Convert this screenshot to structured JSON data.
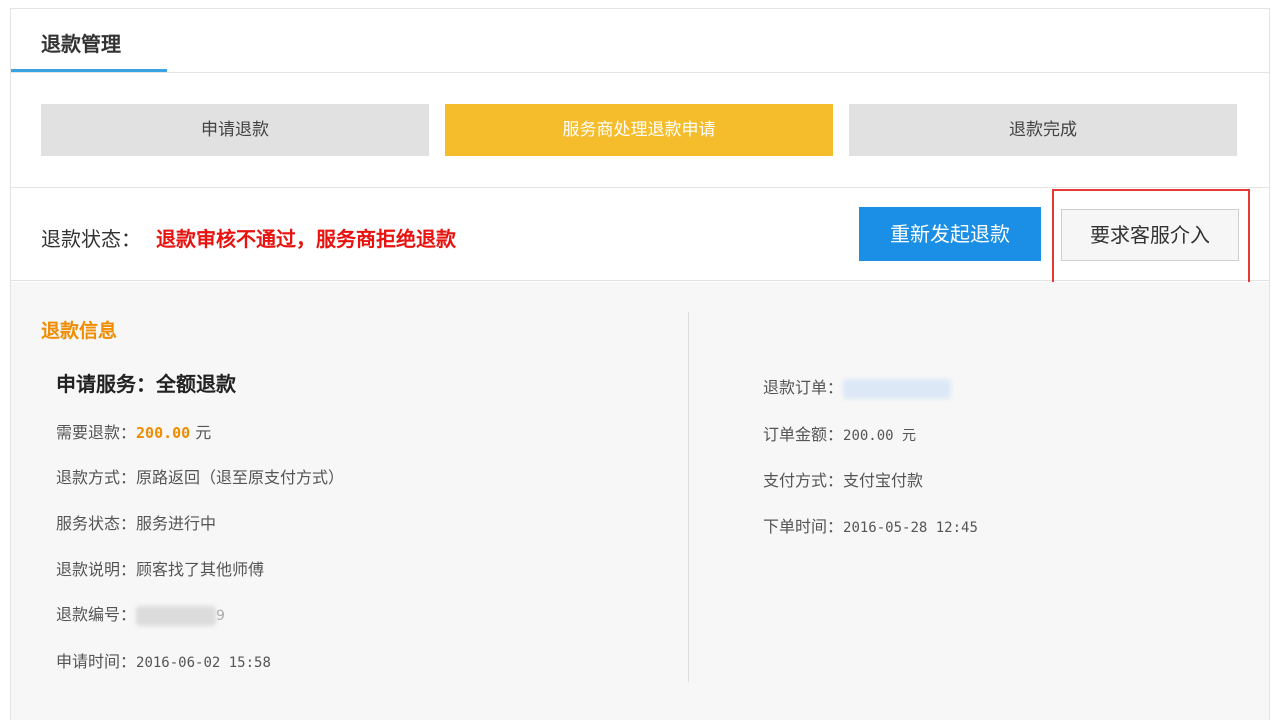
{
  "header": {
    "title": "退款管理"
  },
  "steps": [
    {
      "label": "申请退款"
    },
    {
      "label": "服务商处理退款申请"
    },
    {
      "label": "退款完成"
    }
  ],
  "status": {
    "label": "退款状态：",
    "value": "退款审核不通过，服务商拒绝退款",
    "restart_button": "重新发起退款",
    "support_button": "要求客服介入"
  },
  "info": {
    "title": "退款信息",
    "service": "申请服务：全额退款",
    "left": {
      "refund_amount_label": "需要退款：",
      "refund_amount_value": "200.00",
      "refund_amount_unit": "元",
      "method_label": "退款方式：",
      "method_value": "原路返回（退至原支付方式）",
      "service_status_label": "服务状态：",
      "service_status_value": "服务进行中",
      "note_label": "退款说明：",
      "note_value": "顾客找了其他师傅",
      "number_label": "退款编号：",
      "number_tail": "9",
      "apply_time_label": "申请时间：",
      "apply_time_value": "2016-06-02 15:58"
    },
    "right": {
      "order_label": "退款订单：",
      "order_amount_label": "订单金额：",
      "order_amount_value": "200.00 元",
      "pay_method_label": "支付方式：",
      "pay_method_value": "支付宝付款",
      "order_time_label": "下单时间：",
      "order_time_value": "2016-05-28 12:45"
    }
  },
  "colors": {
    "active_step": "#f5bd2b",
    "status_error": "#e8120f",
    "primary_button": "#1b8fe6",
    "accent_orange": "#f08c00",
    "highlight_border": "#e53935"
  }
}
